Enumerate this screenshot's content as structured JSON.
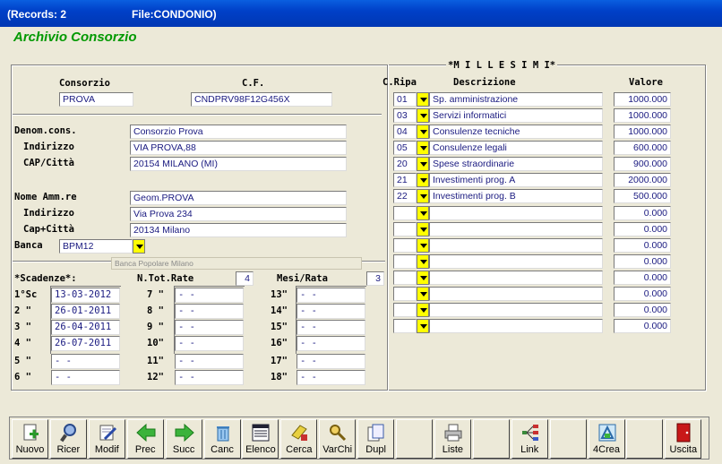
{
  "window": {
    "records": "(Records: 2",
    "file": "File:CONDONIO)"
  },
  "app_title": "Archivio Consorzio",
  "header": {
    "consorzio_label": "Consorzio",
    "cf_label": "C.F.",
    "consorzio": "PROVA",
    "cf": "CNDPRV98F12G456X"
  },
  "cons": {
    "denom_label": "Denom.cons.",
    "indir_label": "Indirizzo",
    "cap_label": "CAP/Città",
    "denom": "Consorzio Prova",
    "indirizzo": "VIA PROVA,88",
    "cap": "20154  MILANO  (MI)"
  },
  "amm": {
    "nome_label": "Nome Amm.re",
    "indir_label": "Indirizzo",
    "cap_label": "Cap+Città",
    "nome": "Geom.PROVA",
    "indirizzo": "Via Prova 234",
    "cap": "20134 Milano"
  },
  "banca": {
    "label": "Banca",
    "code": "BPM12",
    "desc": "Banca Popolare Milano"
  },
  "scad": {
    "label": "*Scadenze*:",
    "ntot_label": "N.Tot.Rate",
    "ntot": "4",
    "mesi_label": "Mesi/Rata",
    "mesi": "3",
    "rows": [
      {
        "l": "1°Sc",
        "v": "13-03-2012"
      },
      {
        "l": "2  \"",
        "v": "26-01-2011"
      },
      {
        "l": "3  \"",
        "v": "26-04-2011"
      },
      {
        "l": "4  \"",
        "v": "26-07-2011"
      },
      {
        "l": "5  \"",
        "v": " -  -"
      },
      {
        "l": "6  \"",
        "v": " -  -"
      },
      {
        "l": "7  \"",
        "v": " -  -"
      },
      {
        "l": "8  \"",
        "v": " -  -"
      },
      {
        "l": "9  \"",
        "v": " -  -"
      },
      {
        "l": "10\"",
        "v": " -  -"
      },
      {
        "l": "11\"",
        "v": " -  -"
      },
      {
        "l": "12\"",
        "v": " -  -"
      },
      {
        "l": "13\"",
        "v": " -  -"
      },
      {
        "l": "14\"",
        "v": " -  -"
      },
      {
        "l": "15\"",
        "v": " -  -"
      },
      {
        "l": "16\"",
        "v": " -  -"
      },
      {
        "l": "17\"",
        "v": " -  -"
      },
      {
        "l": "18\"",
        "v": " -  -"
      }
    ]
  },
  "millesimi": {
    "title": "*M I L L E S I M I*",
    "c_label": "C.Ripa",
    "d_label": "Descrizione",
    "v_label": "Valore",
    "rows": [
      {
        "c": "01",
        "d": "Sp. amministrazione",
        "v": "1000.000"
      },
      {
        "c": "03",
        "d": "Servizi informatici",
        "v": "1000.000"
      },
      {
        "c": "04",
        "d": "Consulenze tecniche",
        "v": "1000.000"
      },
      {
        "c": "05",
        "d": "Consulenze legali",
        "v": "600.000"
      },
      {
        "c": "20",
        "d": "Spese straordinarie",
        "v": "900.000"
      },
      {
        "c": "21",
        "d": "Investimenti prog. A",
        "v": "2000.000"
      },
      {
        "c": "22",
        "d": "Investimenti prog. B",
        "v": "500.000"
      },
      {
        "c": "",
        "d": "",
        "v": "0.000"
      },
      {
        "c": "",
        "d": "",
        "v": "0.000"
      },
      {
        "c": "",
        "d": "",
        "v": "0.000"
      },
      {
        "c": "",
        "d": "",
        "v": "0.000"
      },
      {
        "c": "",
        "d": "",
        "v": "0.000"
      },
      {
        "c": "",
        "d": "",
        "v": "0.000"
      },
      {
        "c": "",
        "d": "",
        "v": "0.000"
      },
      {
        "c": "",
        "d": "",
        "v": "0.000"
      }
    ]
  },
  "toolbar": [
    {
      "label": "Nuovo",
      "icon": "new-document-icon"
    },
    {
      "label": "Ricer",
      "icon": "search-icon"
    },
    {
      "label": "Modif",
      "icon": "edit-icon"
    },
    {
      "label": "Prec",
      "icon": "arrow-left-icon"
    },
    {
      "label": "Succ",
      "icon": "arrow-right-icon"
    },
    {
      "label": "Canc",
      "icon": "trash-icon"
    },
    {
      "label": "Elenco",
      "icon": "list-icon"
    },
    {
      "label": "Cerca",
      "icon": "find-icon"
    },
    {
      "label": "VarChi",
      "icon": "key-icon"
    },
    {
      "label": "Dupl",
      "icon": "duplicate-icon"
    },
    {
      "label": "",
      "icon": ""
    },
    {
      "label": "Liste",
      "icon": "printer-icon"
    },
    {
      "label": "",
      "icon": ""
    },
    {
      "label": "Link",
      "icon": "link-icon"
    },
    {
      "label": "",
      "icon": ""
    },
    {
      "label": "4Crea",
      "icon": "create-icon"
    },
    {
      "label": "",
      "icon": ""
    },
    {
      "label": "Uscita",
      "icon": "exit-door-icon"
    }
  ]
}
